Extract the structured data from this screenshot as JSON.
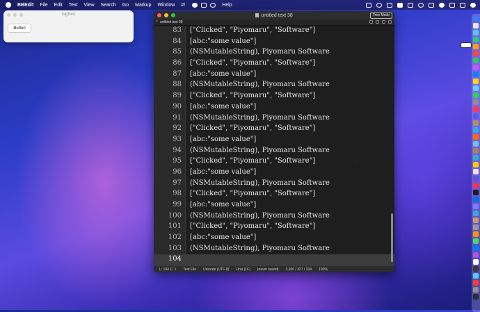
{
  "menubar": {
    "app_name": "BBEdit",
    "items": [
      "File",
      "Edit",
      "Text",
      "View",
      "Search",
      "Go",
      "Markup",
      "Window",
      "#!",
      "Help"
    ]
  },
  "log_window": {
    "title": "logTest",
    "button_label": "Button"
  },
  "editor": {
    "title": "untitled text 38",
    "tab_label": "untitled text 38",
    "free_mode_label": "Free Mode",
    "lines": [
      {
        "num": "83",
        "text": "[\"Clicked\", \"Piyomaru\", \"Software\"]"
      },
      {
        "num": "84",
        "text": "[abc:\"some value\"]"
      },
      {
        "num": "85",
        "text": "(NSMutableString), Piyomaru Software"
      },
      {
        "num": "86",
        "text": "[\"Clicked\", \"Piyomaru\", \"Software\"]"
      },
      {
        "num": "87",
        "text": "[abc:\"some value\"]"
      },
      {
        "num": "88",
        "text": "(NSMutableString), Piyomaru Software"
      },
      {
        "num": "89",
        "text": "[\"Clicked\", \"Piyomaru\", \"Software\"]"
      },
      {
        "num": "90",
        "text": "[abc:\"some value\"]"
      },
      {
        "num": "91",
        "text": "(NSMutableString), Piyomaru Software"
      },
      {
        "num": "92",
        "text": "[\"Clicked\", \"Piyomaru\", \"Software\"]"
      },
      {
        "num": "93",
        "text": "[abc:\"some value\"]"
      },
      {
        "num": "94",
        "text": "(NSMutableString), Piyomaru Software"
      },
      {
        "num": "95",
        "text": "[\"Clicked\", \"Piyomaru\", \"Software\"]"
      },
      {
        "num": "96",
        "text": "[abc:\"some value\"]"
      },
      {
        "num": "97",
        "text": "(NSMutableString), Piyomaru Software"
      },
      {
        "num": "98",
        "text": "[\"Clicked\", \"Piyomaru\", \"Software\"]"
      },
      {
        "num": "99",
        "text": "[abc:\"some value\"]"
      },
      {
        "num": "100",
        "text": "(NSMutableString), Piyomaru Software"
      },
      {
        "num": "101",
        "text": "[\"Clicked\", \"Piyomaru\", \"Software\"]"
      },
      {
        "num": "102",
        "text": "[abc:\"some value\"]"
      },
      {
        "num": "103",
        "text": "(NSMutableString), Piyomaru Software"
      },
      {
        "num": "104",
        "text": ""
      }
    ],
    "status": {
      "position": "L: 104 C: 1",
      "file_type": "Text File",
      "encoding": "Unicode (UTF-8)",
      "line_endings": "Unix (LF)",
      "save_state": "(never saved)",
      "counts": "3,160 / 327 / 104",
      "zoom": "100%"
    }
  },
  "colors": {
    "editor_bg": "#1e1e1e",
    "gutter_bg": "#2a2a2a",
    "current_line_bg": "#3c3c3c",
    "close_button": "#ff5f57",
    "minimize_button": "#febc2e",
    "zoom_button": "#28c840"
  }
}
